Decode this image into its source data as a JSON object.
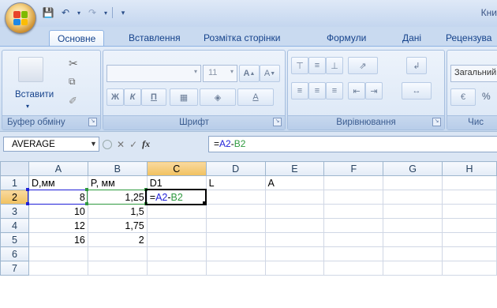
{
  "window": {
    "title": "Кни"
  },
  "office_logo_colors": [
    "#e8442a",
    "#7fba00",
    "#1e88e5",
    "#fbbc05"
  ],
  "tabs": [
    {
      "label": "Основне",
      "active": true
    },
    {
      "label": "Вставлення",
      "active": false
    },
    {
      "label": "Розмітка сторінки",
      "active": false
    },
    {
      "label": "Формули",
      "active": false
    },
    {
      "label": "Дані",
      "active": false
    },
    {
      "label": "Рецензува",
      "active": false
    }
  ],
  "ribbon": {
    "clipboard": {
      "label": "Буфер обміну",
      "paste_label": "Вставити"
    },
    "font": {
      "label": "Шрифт",
      "font_size": "11",
      "bold": "Ж",
      "italic": "К",
      "underline": "П"
    },
    "alignment": {
      "label": "Вирівнювання"
    },
    "number": {
      "label": "Чис",
      "format": "Загальний",
      "percent": "%"
    }
  },
  "formula_bar": {
    "name_box": "AVERAGE",
    "fx": "fx",
    "formula": {
      "eq": "=",
      "ref_a": "A2",
      "op": "-",
      "ref_b": "B2"
    }
  },
  "sheet": {
    "columns": [
      "A",
      "B",
      "C",
      "D",
      "E",
      "F",
      "G",
      "H"
    ],
    "rows": [
      {
        "num": "1",
        "cells": [
          "D,мм",
          "P, мм",
          "D1",
          "L",
          "A",
          "",
          "",
          ""
        ]
      },
      {
        "num": "2",
        "cells": [
          "8",
          "1,25",
          "",
          "",
          "",
          "",
          "",
          ""
        ]
      },
      {
        "num": "3",
        "cells": [
          "10",
          "1,5",
          "",
          "",
          "",
          "",
          "",
          ""
        ]
      },
      {
        "num": "4",
        "cells": [
          "12",
          "1,75",
          "",
          "",
          "",
          "",
          "",
          ""
        ]
      },
      {
        "num": "5",
        "cells": [
          "16",
          "2",
          "",
          "",
          "",
          "",
          "",
          ""
        ]
      },
      {
        "num": "6",
        "cells": [
          "",
          "",
          "",
          "",
          "",
          "",
          "",
          ""
        ]
      },
      {
        "num": "7",
        "cells": [
          "",
          "",
          "",
          "",
          "",
          "",
          "",
          ""
        ]
      }
    ],
    "active_cell_formula": {
      "eq": "=",
      "ref_a": "A2",
      "op": "-",
      "ref_b": "B2"
    },
    "selected_column": "C",
    "selected_row": "2"
  },
  "colors": {
    "ref_a": "#1f1fd8",
    "ref_b": "#2f9a3f",
    "header_selected": "#f1c15f"
  }
}
